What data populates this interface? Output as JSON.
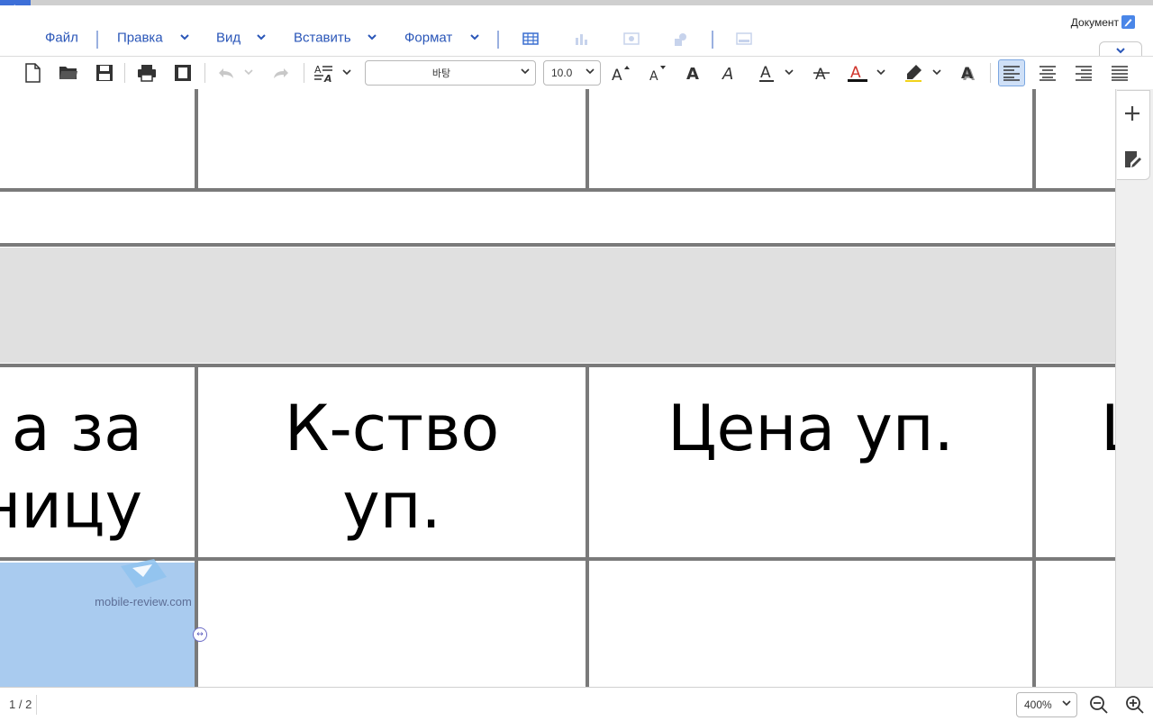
{
  "menu": {
    "file": "Файл",
    "edit": "Правка",
    "view": "Вид",
    "insert": "Вставить",
    "format": "Формат"
  },
  "document_label": "Документ",
  "toolbar": {
    "font_name": "바탕",
    "font_size": "10.0"
  },
  "table": {
    "header_cells": [
      "а за\nницу",
      "К-ство\nуп.",
      "Цена уп.",
      "Ц"
    ]
  },
  "watermark": "mobile-review.com",
  "status": {
    "page_indicator": "1 / 2",
    "zoom": "400%"
  },
  "colors": {
    "accent": "#2a56b8",
    "back_button": "#3d6fd8",
    "selection": "#a9cbef",
    "table_border": "#7a7a7a",
    "gray_row": "#e0e0e0"
  }
}
